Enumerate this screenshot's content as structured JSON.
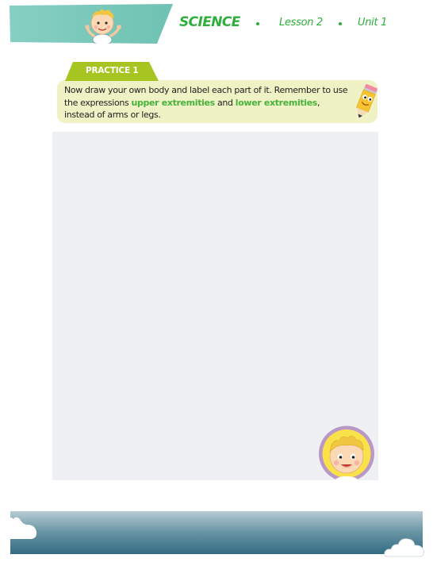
{
  "header": {
    "subject": "SCIENCE",
    "lesson": "Lesson 2",
    "unit": "Unit 1",
    "accent_color": "#2fae3c",
    "banner_color": "#7cc9bb"
  },
  "practice": {
    "label": "PRACTICE 1",
    "tab_color": "#a6c520",
    "instruction_part1": "Now draw your own body and label each part of it. Remember to use the expressions ",
    "keyword1": "upper extremities",
    "instruction_mid": " and ",
    "keyword2": "lower extremities",
    "instruction_part2": ", instead of arms or legs.",
    "icon": "pencil-mascot-icon"
  },
  "drawing_area": {
    "background": "#eef0f4"
  },
  "mascot": {
    "icon": "kid-face-icon",
    "ring_color": "#b998c6"
  },
  "footer": {
    "icons": [
      "cloud-icon",
      "cloud-icon"
    ]
  }
}
